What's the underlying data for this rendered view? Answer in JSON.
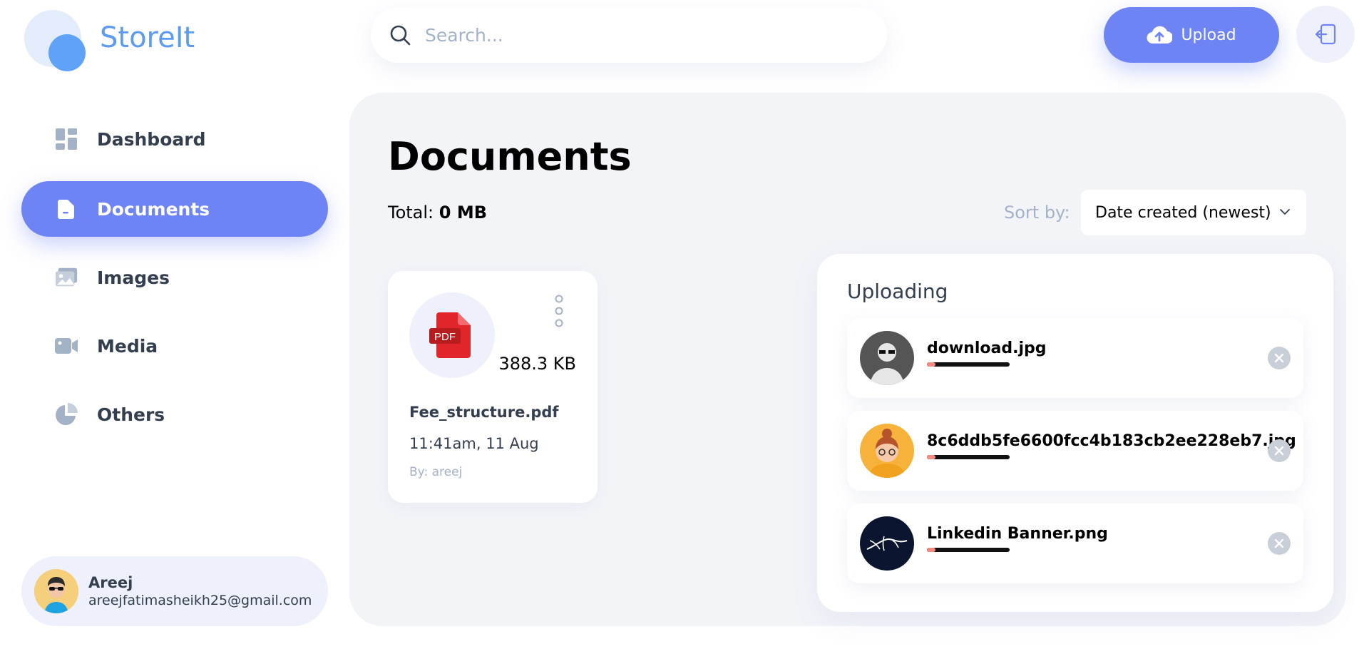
{
  "app": {
    "name": "StoreIt"
  },
  "sidebar": {
    "items": [
      {
        "label": "Dashboard",
        "icon": "dashboard-icon",
        "active": false
      },
      {
        "label": "Documents",
        "icon": "document-icon",
        "active": true
      },
      {
        "label": "Images",
        "icon": "image-icon",
        "active": false
      },
      {
        "label": "Media",
        "icon": "video-icon",
        "active": false
      },
      {
        "label": "Others",
        "icon": "pie-chart-icon",
        "active": false
      }
    ],
    "user": {
      "name": "Areej",
      "email": "areejfatimasheikh25@gmail.com"
    }
  },
  "header": {
    "search": {
      "placeholder": "Search..."
    },
    "upload_label": "Upload"
  },
  "main": {
    "title": "Documents",
    "total_label": "Total:",
    "total_value": "0 MB",
    "sort_label": "Sort by:",
    "sort_value": "Date created (newest)",
    "files": [
      {
        "name": "Fee_structure.pdf",
        "size": "388.3 KB",
        "date": "11:41am, 11 Aug",
        "owner": "By: areej",
        "type_label": "PDF"
      }
    ]
  },
  "uploading": {
    "title": "Uploading",
    "items": [
      {
        "name": "download.jpg",
        "progress": 0.1
      },
      {
        "name": "8c6ddb5fe6600fcc4b183cb2ee228eb7.jpg",
        "progress": 0.1
      },
      {
        "name": "Linkedin Banner.png",
        "progress": 0.1
      }
    ]
  },
  "colors": {
    "brand": "#6E84F4",
    "logo": "#5b9bf2",
    "panel_bg": "#F2F4F8",
    "pdf_red": "#E0262B"
  }
}
